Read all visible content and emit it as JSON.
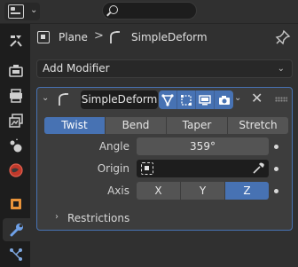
{
  "header": {
    "editor_type_icon": "properties-editor-icon",
    "search_icon": "search-icon"
  },
  "tabs": [
    {
      "name": "tool-tab",
      "icon": "wrench-screwdriver-icon",
      "active": false
    },
    {
      "name": "render-tab",
      "icon": "camera-back-icon",
      "active": false
    },
    {
      "name": "output-tab",
      "icon": "printer-icon",
      "active": false
    },
    {
      "name": "view-layer-tab",
      "icon": "image-stack-icon",
      "active": false
    },
    {
      "name": "scene-tab",
      "icon": "scene-icon",
      "active": false
    },
    {
      "name": "world-tab",
      "icon": "globe-icon",
      "active": false
    },
    {
      "name": "object-tab",
      "icon": "cube-icon",
      "active": false
    },
    {
      "name": "modifiers-tab",
      "icon": "wrench-icon",
      "active": true
    },
    {
      "name": "constraints-tab",
      "icon": "constraint-icon",
      "active": false
    }
  ],
  "breadcrumb": {
    "object": "Plane",
    "separator": ">",
    "modifier": "SimpleDeform"
  },
  "add_modifier": {
    "label": "Add Modifier"
  },
  "modifier": {
    "name": "SimpleDeform",
    "modes": [
      "Twist",
      "Bend",
      "Taper",
      "Stretch"
    ],
    "active_mode": "Twist",
    "angle_label": "Angle",
    "angle_value": "359°",
    "origin_label": "Origin",
    "origin_value": "",
    "axis_label": "Axis",
    "axes": [
      "X",
      "Y",
      "Z"
    ],
    "active_axis": "Z",
    "restrictions_label": "Restrictions",
    "close_glyph": "✕"
  },
  "colors": {
    "accent": "#4772b3",
    "panel_bg": "#3d3d3d",
    "editor_bg": "#303030",
    "field_dark": "#1d1d1d",
    "button_bg": "#545454"
  }
}
